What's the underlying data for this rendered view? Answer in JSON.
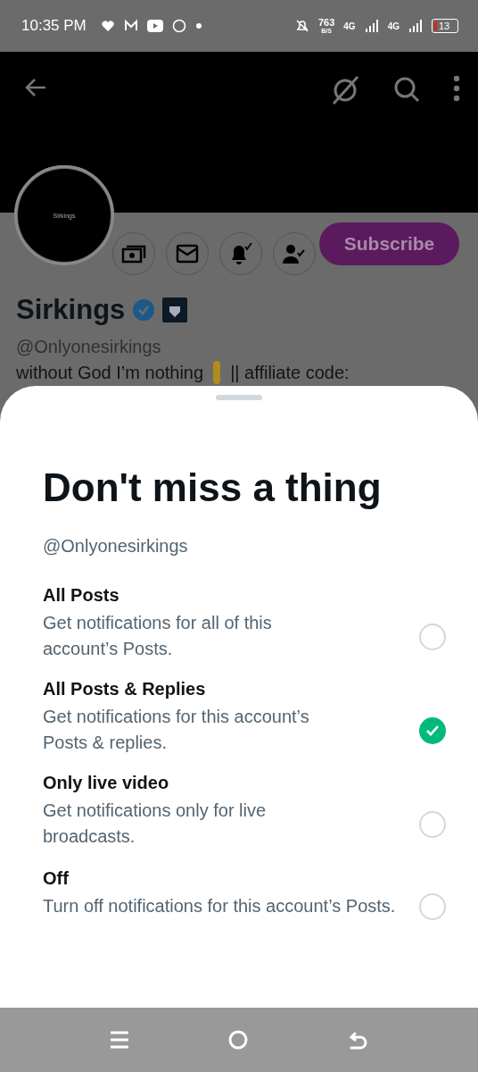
{
  "status_bar": {
    "time": "10:35 PM",
    "net_speed": "763",
    "net_unit": "B/S",
    "sim_1": "4G",
    "sim_2": "4G",
    "battery": "13"
  },
  "profile": {
    "avatar_text": "Sirkings",
    "subscribe": "Subscribe",
    "name": "Sirkings",
    "handle": "@Onlyonesirkings",
    "bio": "without God I’m nothing",
    "bio_rest": "|| affiliate code:"
  },
  "sheet": {
    "title": "Don't miss a thing",
    "handle": "@Onlyonesirkings",
    "options": [
      {
        "title": "All Posts",
        "description": "Get notifications for all of this account’s Posts.",
        "selected": false
      },
      {
        "title": "All Posts & Replies",
        "description": "Get notifications for this account’s Posts & replies.",
        "selected": true
      },
      {
        "title": "Only live video",
        "description": "Get notifications only for live broadcasts.",
        "selected": false
      },
      {
        "title": "Off",
        "description": "Turn off notifications for this account’s Posts.",
        "selected": false
      }
    ]
  }
}
